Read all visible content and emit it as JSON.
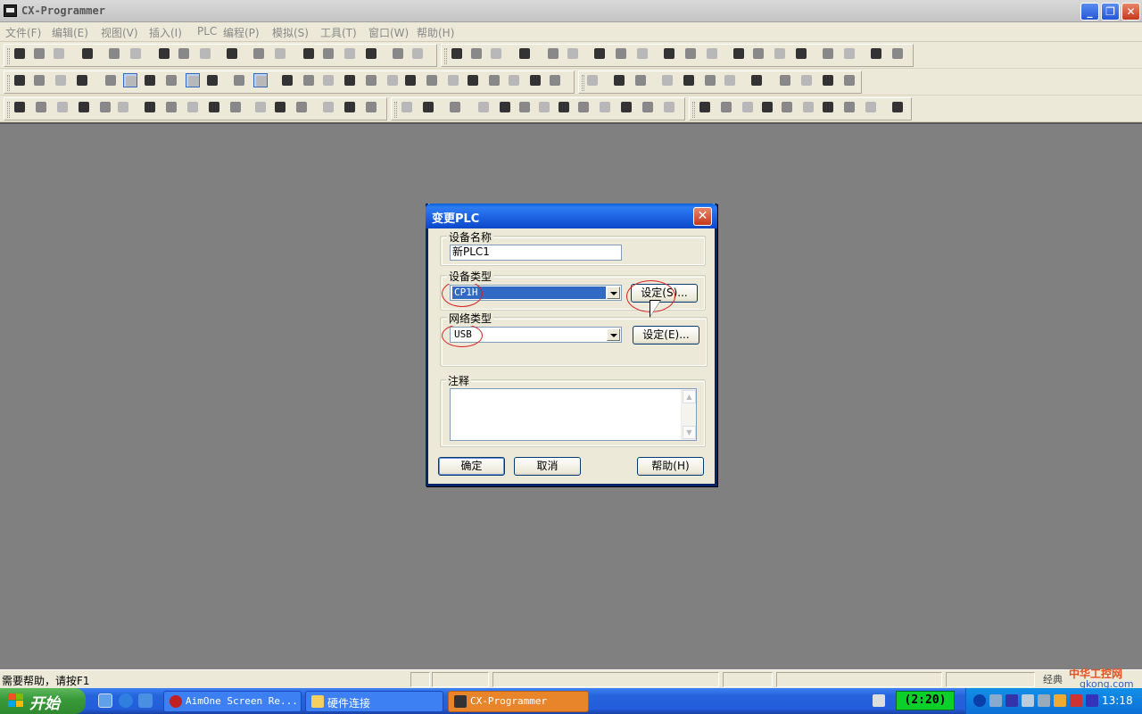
{
  "window": {
    "title": "CX-Programmer",
    "min_glyph": "_",
    "max_glyph": "❐",
    "close_glyph": "✕"
  },
  "menu": [
    "文件(F)",
    "编辑(E)",
    "视图(V)",
    "插入(I)",
    "PLC",
    "编程(P)",
    "模拟(S)",
    "工具(T)",
    "窗口(W)",
    "帮助(H)"
  ],
  "dialog": {
    "title": "变更PLC",
    "close_glyph": "✕",
    "device_name_label": "设备名称",
    "device_name_value": "新PLC1",
    "device_type_label": "设备类型",
    "device_type_value": "CP1H",
    "device_type_settings": "设定(S)...",
    "network_type_label": "网络类型",
    "network_type_value": "USB",
    "network_type_settings": "设定(E)...",
    "comment_label": "注释",
    "comment_value": "",
    "ok": "确定",
    "cancel": "取消",
    "help": "帮助(H)"
  },
  "status": {
    "help_text": "需要帮助，请按F1"
  },
  "taskbar": {
    "start": "开始",
    "tasks": [
      {
        "label": "AimOne Screen Re..."
      },
      {
        "label": "硬件连接"
      },
      {
        "label": "CX-Programmer"
      }
    ],
    "timer": "(2:20)",
    "clock": "13:18"
  },
  "watermark": {
    "line1": "中华工控网",
    "line2": "gkong.com",
    "partial": "经典"
  },
  "colors": {
    "accent": "#0a246a",
    "selection": "#316ac5",
    "annotation": "#d82020"
  }
}
